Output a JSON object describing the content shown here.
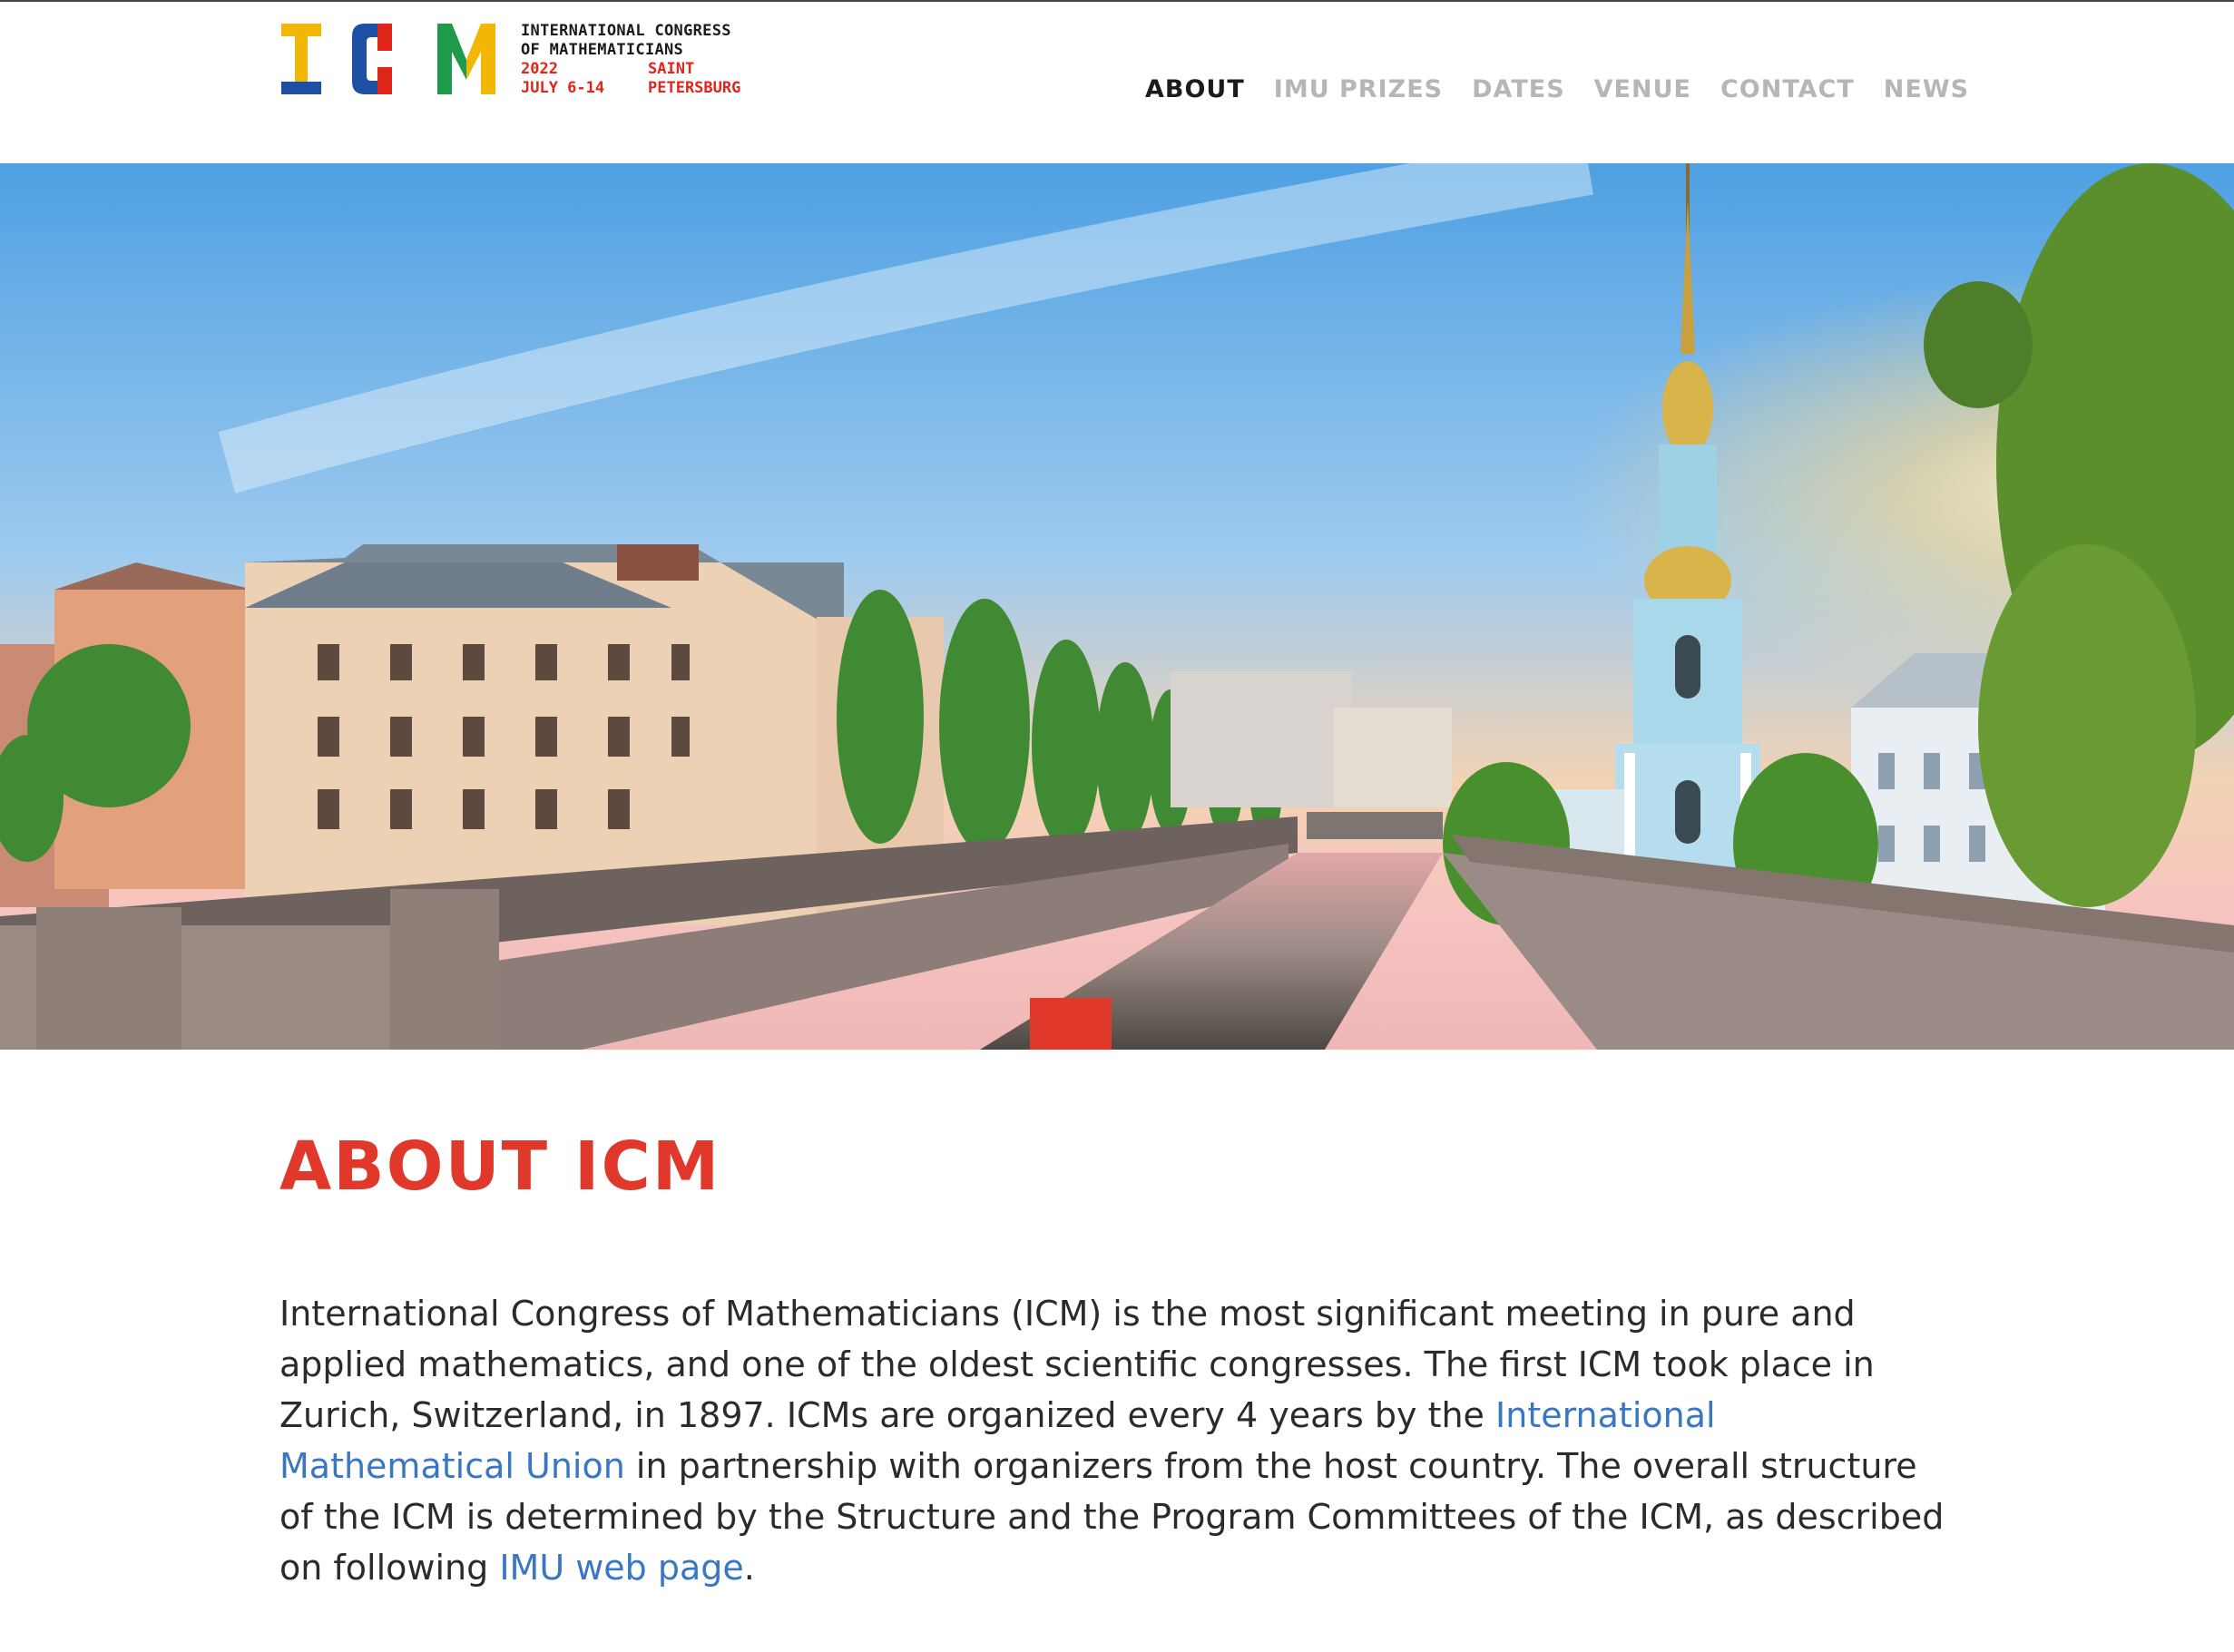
{
  "brand": {
    "logo_letters": [
      "I",
      "C",
      "M"
    ],
    "line1": "INTERNATIONAL CONGRESS",
    "line2": "OF MATHEMATICIANS",
    "year": "2022",
    "city_line1": "SAINT",
    "dates": "JULY 6-14",
    "city_line2": "PETERSBURG",
    "colors": {
      "yellow": "#f2b705",
      "blue": "#1f4fa3",
      "red": "#e0251b",
      "green": "#1f9a4b"
    }
  },
  "nav": {
    "items": [
      {
        "label": "ABOUT",
        "active": true
      },
      {
        "label": "IMU PRIZES",
        "active": false
      },
      {
        "label": "DATES",
        "active": false
      },
      {
        "label": "VENUE",
        "active": false
      },
      {
        "label": "CONTACT",
        "active": false
      },
      {
        "label": "NEWS",
        "active": false
      }
    ]
  },
  "about": {
    "title": "ABOUT ICM",
    "text_1": "International Congress of Mathematicians (ICM) is the most significant meeting in pure and applied mathematics, and one of the oldest scientific congresses. The first ICM took place in Zurich, Switzerland, in 1897. ICMs are organized every 4 years by the ",
    "link_imu": "International Mathematical Union",
    "text_2": " in partnership with organizers from the host country. The overall structure of the ICM is determined by the Structure and the Program Committees of the ICM, as described on following ",
    "link_page": "IMU web page",
    "text_3": "."
  },
  "colors": {
    "accent_red": "#e0382b",
    "link_blue": "#3a77c2",
    "nav_active": "#1b1b1b",
    "nav_inactive": "#b6b6b6",
    "body_text": "#2b2b2b"
  }
}
